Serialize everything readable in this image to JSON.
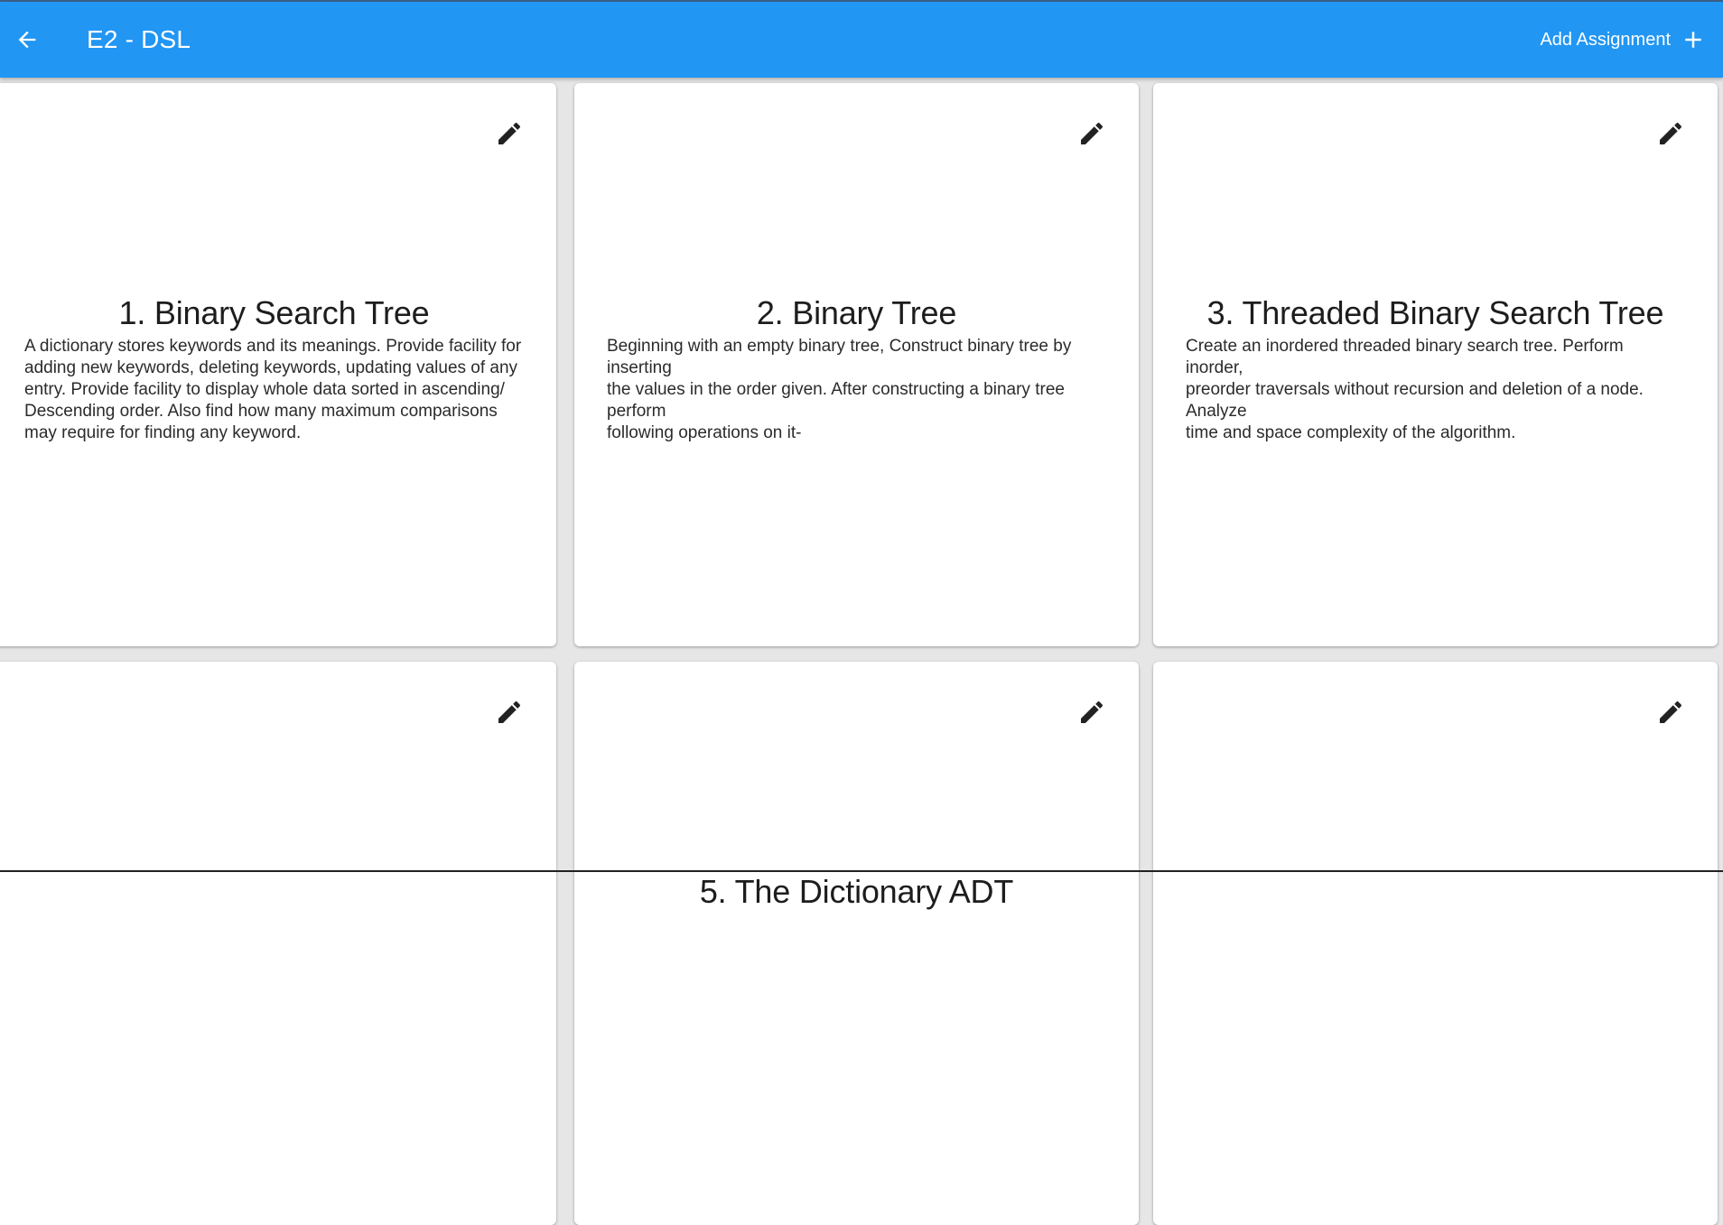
{
  "appbar": {
    "back_icon": "arrow-left-icon",
    "title": "E2 - DSL",
    "add_label": "Add Assignment",
    "add_icon": "plus-icon",
    "color": "#2196f3"
  },
  "cards": [
    {
      "title": "1. Binary Search Tree",
      "description": "A dictionary stores keywords and its meanings. Provide facility for adding new keywords, deleting keywords, updating values of any entry. Provide facility to display whole data sorted in ascending/ Descending order. Also find how many maximum comparisons may require for finding any keyword.",
      "edit_icon": "pencil-icon"
    },
    {
      "title": "2. Binary Tree",
      "description": "Beginning with an empty binary tree, Construct binary tree by inserting\nthe values in the order given. After constructing a binary tree perform\nfollowing operations on it-",
      "edit_icon": "pencil-icon"
    },
    {
      "title": "3. Threaded Binary Search Tree",
      "description": "Create an inordered threaded binary search tree. Perform inorder,\npreorder traversals without recursion and deletion of a node. Analyze\ntime and space complexity of the algorithm.",
      "edit_icon": "pencil-icon"
    },
    {
      "title": "",
      "description": "",
      "edit_icon": "pencil-icon"
    },
    {
      "title": "5. The Dictionary ADT",
      "description": "",
      "edit_icon": "pencil-icon"
    },
    {
      "title": "",
      "description": "",
      "edit_icon": "pencil-icon"
    }
  ]
}
